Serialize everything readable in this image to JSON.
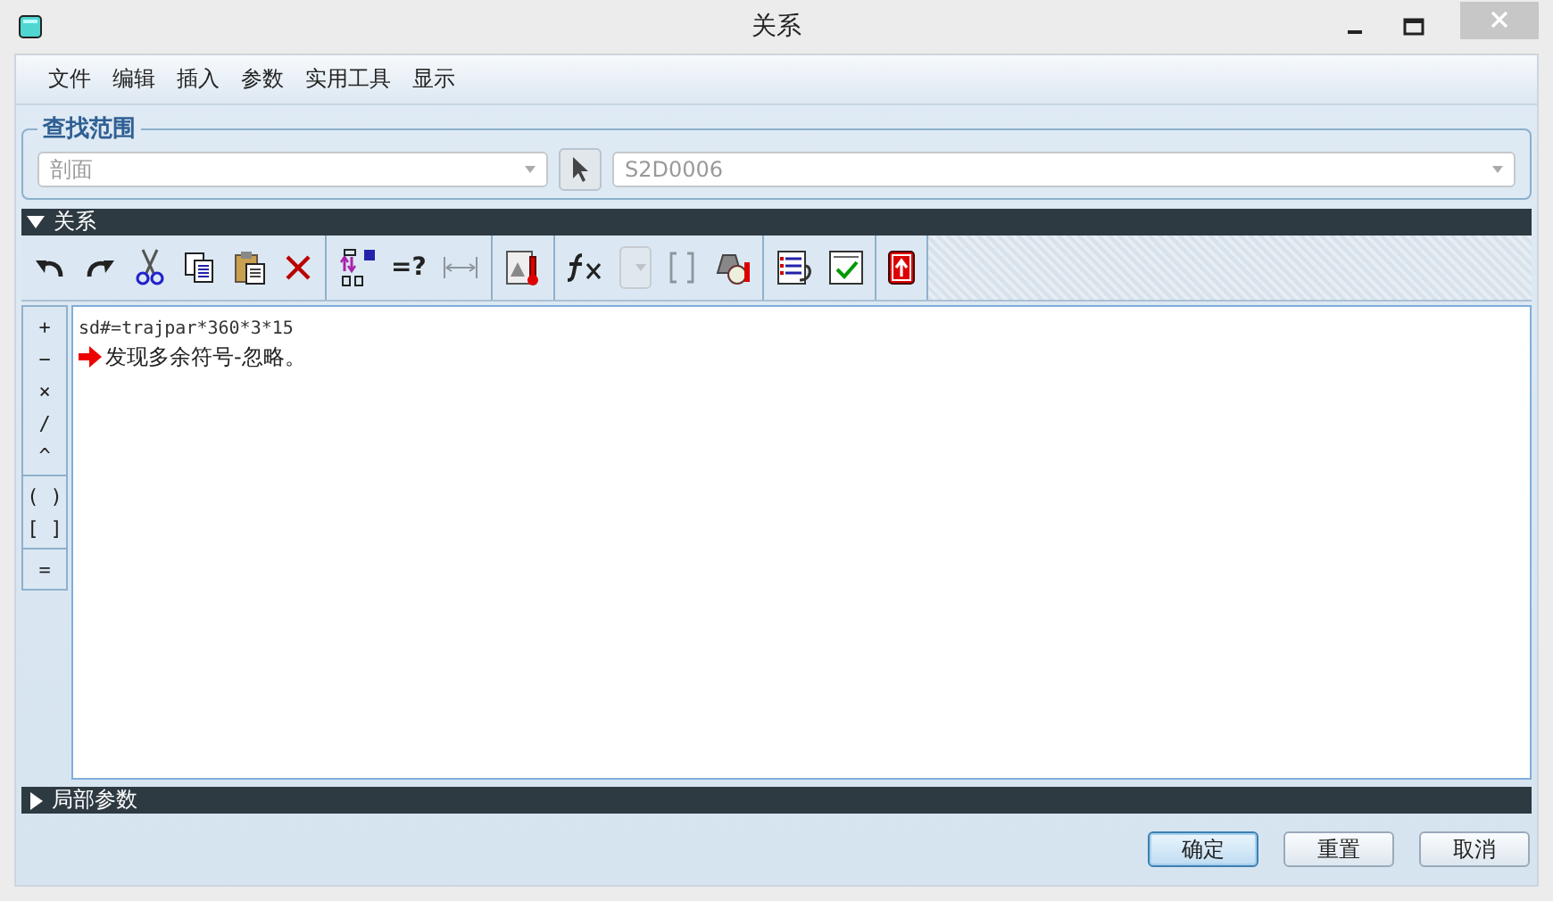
{
  "window": {
    "title": "关系"
  },
  "menu": [
    "文件",
    "编辑",
    "插入",
    "参数",
    "实用工具",
    "显示"
  ],
  "scope": {
    "title": "查找范围",
    "type_field": {
      "value": "剖面",
      "disabled": true
    },
    "object_field": {
      "value": "S2D0006",
      "disabled": true
    }
  },
  "relations_section": {
    "title": "关系",
    "expanded": true
  },
  "toolbar": [
    [
      {
        "kind": "undo",
        "disabled": false
      },
      {
        "kind": "redo",
        "disabled": false
      },
      {
        "kind": "cut",
        "disabled": false
      },
      {
        "kind": "copy",
        "disabled": false
      },
      {
        "kind": "paste",
        "disabled": false
      },
      {
        "kind": "delete",
        "disabled": false
      }
    ],
    [
      {
        "kind": "dims",
        "disabled": false
      },
      {
        "kind": "eval",
        "label": "=?",
        "disabled": false
      },
      {
        "kind": "measure",
        "disabled": true
      }
    ],
    [
      {
        "kind": "thermo",
        "disabled": false
      }
    ],
    [
      {
        "kind": "fx",
        "disabled": false
      },
      {
        "kind": "dropdown",
        "disabled": true
      },
      {
        "kind": "brackets",
        "disabled": true
      },
      {
        "kind": "weight",
        "disabled": false
      }
    ],
    [
      {
        "kind": "list",
        "disabled": false
      },
      {
        "kind": "verify",
        "disabled": false
      }
    ],
    [
      {
        "kind": "exit",
        "disabled": false
      }
    ]
  ],
  "operators": [
    [
      "+",
      "−",
      "×",
      "/",
      "^"
    ],
    [
      "( )",
      "[ ]"
    ],
    [
      "="
    ]
  ],
  "editor_lines": [
    {
      "kind": "code",
      "text": "sd#=trajpar*360*3*15"
    },
    {
      "kind": "error",
      "text": "发现多余符号-忽略。"
    }
  ],
  "local_params_section": {
    "title": "局部参数",
    "expanded": false
  },
  "buttons": [
    {
      "label": "确定",
      "default": true
    },
    {
      "label": "重置",
      "default": false
    },
    {
      "label": "取消",
      "default": false
    }
  ]
}
